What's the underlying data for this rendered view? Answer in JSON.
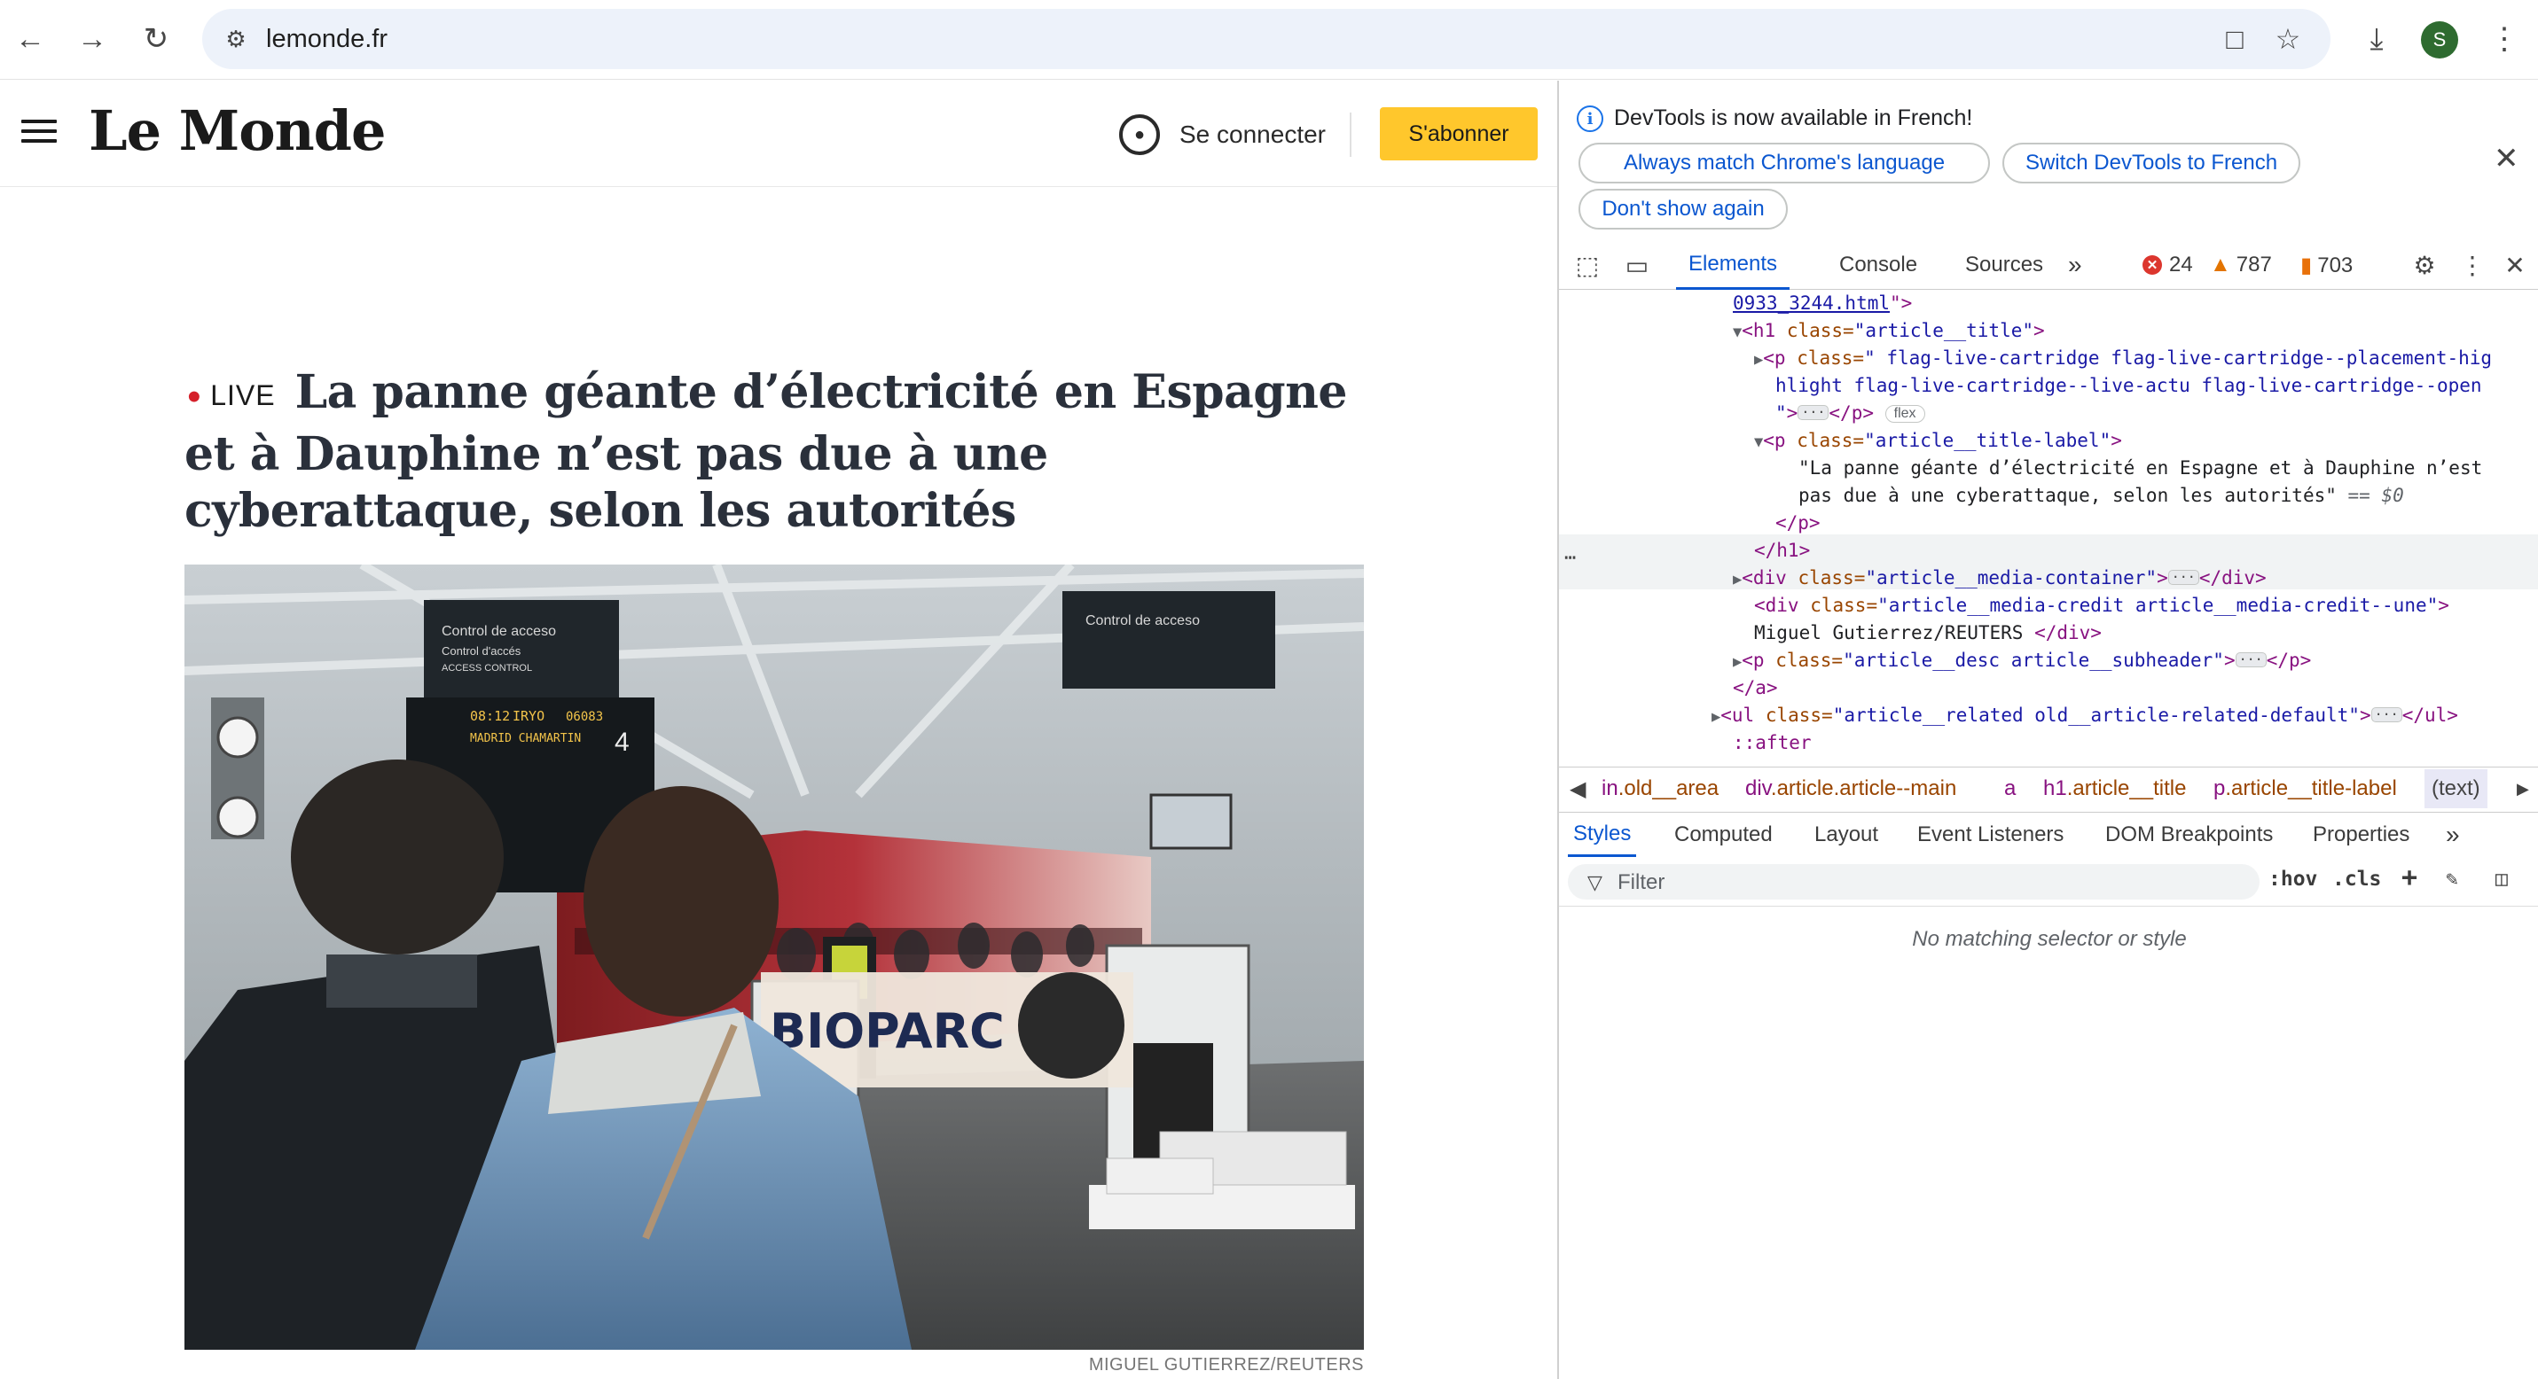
{
  "browser": {
    "url": "lemonde.fr",
    "profile_initial": "S",
    "icons": [
      "back-icon",
      "forward-icon",
      "reload-icon",
      "site-info-icon",
      "install-icon",
      "bookmark-star-icon",
      "download-icon",
      "menu-kebab-icon"
    ]
  },
  "site": {
    "logo": "Le Monde",
    "connect_label": "Se connecter",
    "subscribe_label": "S'abonner",
    "live_label": "LIVE",
    "headline": "La panne géante d’électricité en Espagne et à Dauphine n’est pas due à une cyberattaque, selon les autorités",
    "photo_credit": "MIGUEL GUTIERREZ/REUTERS",
    "photo_signs": {
      "sign_line1": "Control de acceso",
      "sign_line2": "Control d'accés",
      "sign_line3": "ACCESS CONTROL",
      "board_time": "08:12",
      "board_line": "IRYO",
      "board_train": "06083",
      "board_dest": "MADRID CHAMARTIN",
      "platform": "4",
      "banner": "BIOPARC"
    }
  },
  "devtools": {
    "info_text": "DevTools is now available in French!",
    "btn_always": "Always match Chrome's language",
    "btn_switch": "Switch DevTools to French",
    "btn_dont": "Don't show again",
    "tabs": [
      "Elements",
      "Console",
      "Sources"
    ],
    "active_tab": "Elements",
    "errors": "24",
    "warnings": "787",
    "issues": "703",
    "colors": {
      "accent": "#0b57d0",
      "error": "#dc362e",
      "warning": "#e37400",
      "issue": "#e8710a",
      "subscribe": "#ffc72c",
      "live": "#d5202a"
    },
    "dom": {
      "l1_link": "0933_3244.html",
      "l1_end": "\">",
      "l2_tag": "<h1",
      "l2_attr": "class=",
      "l2_val": "\"article__title\"",
      "l2_end": ">",
      "l3_tag": "<p",
      "l3_attr": "class=",
      "l3_val": "\" flag-live-cartridge flag-live-cartridge--placement-hig",
      "l4_val": "hlight flag-live-cartridge--live-actu flag-live-cartridge--open",
      "l5_q": "\"",
      "l5_end": ">",
      "l5_close": "</p>",
      "flex_badge": "flex",
      "l6_tag": "<p",
      "l6_attr": "class=",
      "l6_val": "\"article__title-label\"",
      "l6_end": ">",
      "l7_text": "\"La panne géante d’électricité en Espagne et à Dauphine n’est",
      "l8_text": "pas due à une cyberattaque, selon les autorités\"",
      "l8_sel": "== $0",
      "l9": "</p>",
      "l10": "</h1>",
      "l11_tag": "<div",
      "l11_attr": "class=",
      "l11_val": "\"article__media-container\"",
      "l11_end": ">",
      "l11_close": "</div>",
      "l12_tag": "<div",
      "l12_attr": "class=",
      "l12_val": "\"article__media-credit article__media-credit--une\"",
      "l12_end": ">",
      "l13_text": "Miguel Gutierrez/REUTERS ",
      "l13_close": "</div>",
      "l14_tag": "<p",
      "l14_attr": "class=",
      "l14_val": "\"article__desc article__subheader\"",
      "l14_end": ">",
      "l14_close": "</p>",
      "l15": "</a>",
      "l16_tag": "<ul",
      "l16_attr": "class=",
      "l16_val": "\"article__related old__article-related-default\"",
      "l16_end": ">",
      "l16_close": "</ul>",
      "l17": "::after",
      "ellipsis": "···"
    },
    "breadcrumbs": [
      {
        "tag": "in",
        "cls": ".old__area"
      },
      {
        "tag": "div",
        "cls": ".article.article--main"
      },
      {
        "tag": "a",
        "cls": ""
      },
      {
        "tag": "h1",
        "cls": ".article__title"
      },
      {
        "tag": "p",
        "cls": ".article__title-label"
      },
      {
        "tag": "(text)",
        "cls": ""
      }
    ],
    "styles_tabs": [
      "Styles",
      "Computed",
      "Layout",
      "Event Listeners",
      "DOM Breakpoints",
      "Properties"
    ],
    "filter_placeholder": "Filter",
    "hov": ":hov",
    "cls": ".cls",
    "no_match": "No matching selector or style"
  }
}
